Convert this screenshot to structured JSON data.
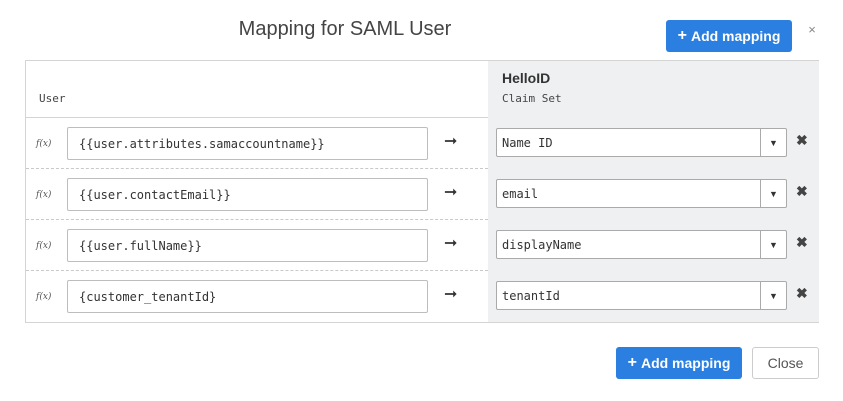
{
  "dialog": {
    "title": "Mapping for SAML User",
    "close_symbol": "×",
    "add_mapping_label": "Add mapping",
    "add_icon": "+",
    "close_button_label": "Close"
  },
  "table": {
    "left_header": "User",
    "right_header_title": "HelloID",
    "right_header_subtitle": "Claim Set",
    "rows": [
      {
        "fx": "f(x)",
        "source": "{{user.attributes.samaccountname}}",
        "arrow": "➞",
        "target": "Name ID",
        "caret": "▼",
        "delete": "✖"
      },
      {
        "fx": "f(x)",
        "source": "{{user.contactEmail}}",
        "arrow": "➞",
        "target": "email",
        "caret": "▼",
        "delete": "✖"
      },
      {
        "fx": "f(x)",
        "source": "{{user.fullName}}",
        "arrow": "➞",
        "target": "displayName",
        "caret": "▼",
        "delete": "✖"
      },
      {
        "fx": "f(x)",
        "source": "{customer_tenantId}",
        "arrow": "➞",
        "target": "tenantId",
        "caret": "▼",
        "delete": "✖"
      }
    ]
  },
  "colors": {
    "primary": "#2a7fe0",
    "claim_panel_bg": "#eff0f2"
  }
}
